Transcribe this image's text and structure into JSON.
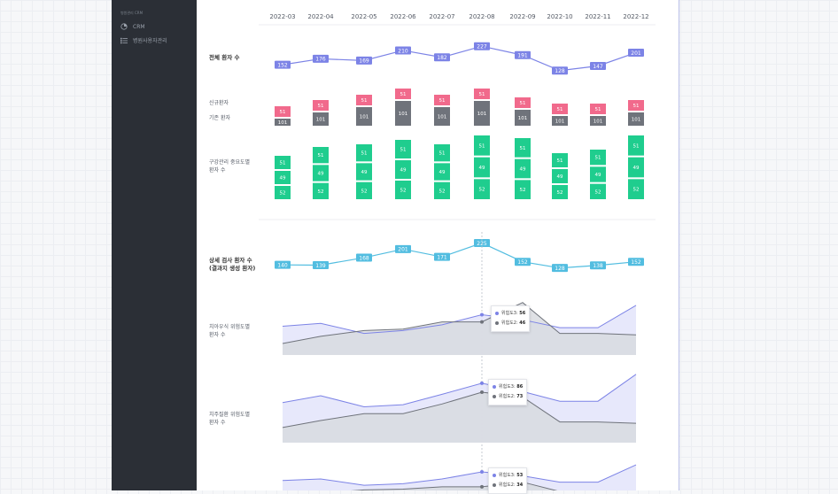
{
  "sidebar": {
    "section_title": "병원관리 CRM",
    "items": [
      {
        "label": "CRM",
        "icon": "chart-pie-icon"
      },
      {
        "label": "병원사용자관리",
        "icon": "list-icon"
      }
    ]
  },
  "months": [
    "2022-03",
    "2022-04",
    "2022-05",
    "2022-06",
    "2022-07",
    "2022-08",
    "2022-09",
    "2022-10",
    "2022-11",
    "2022-12"
  ],
  "labels": {
    "total_patients": "전체 환자 수",
    "new_patients": "신규환자",
    "existing_patients": "기존 환자",
    "oral_mgmt": "구강관리 중요도별\n환자 수",
    "detailed_exam": "상세 검사 환자 수\n(결과지 생성 환자)",
    "caries_risk": "치아우식 위험도별\n환자 수",
    "perio_risk": "치주질환 위험도별\n환자 수"
  },
  "colors": {
    "purple": "#7c83e6",
    "pink": "#f16a8c",
    "gray": "#6f737b",
    "green": "#1fcd8e",
    "cyan": "#52bde0"
  },
  "chart_data": [
    {
      "type": "line",
      "name": "total_patients",
      "categories": [
        "2022-03",
        "2022-04",
        "2022-05",
        "2022-06",
        "2022-07",
        "2022-08",
        "2022-09",
        "2022-10",
        "2022-11",
        "2022-12"
      ],
      "values": [
        152,
        176,
        169,
        210,
        182,
        227,
        191,
        128,
        147,
        201
      ]
    },
    {
      "type": "bar",
      "name": "new_vs_existing",
      "categories": [
        "2022-03",
        "2022-04",
        "2022-05",
        "2022-06",
        "2022-07",
        "2022-08",
        "2022-09",
        "2022-10",
        "2022-11",
        "2022-12"
      ],
      "series": [
        {
          "name": "신규환자",
          "values": [
            51,
            51,
            51,
            51,
            51,
            51,
            51,
            51,
            51,
            51
          ]
        },
        {
          "name": "기존 환자",
          "values": [
            101,
            101,
            101,
            101,
            101,
            101,
            101,
            101,
            101,
            101
          ]
        }
      ]
    },
    {
      "type": "bar",
      "name": "oral_mgmt_importance",
      "categories": [
        "2022-03",
        "2022-04",
        "2022-05",
        "2022-06",
        "2022-07",
        "2022-08",
        "2022-09",
        "2022-10",
        "2022-11",
        "2022-12"
      ],
      "series": [
        {
          "values": [
            51,
            51,
            51,
            51,
            51,
            51,
            51,
            51,
            51,
            51
          ]
        },
        {
          "values": [
            49,
            49,
            49,
            49,
            49,
            49,
            49,
            49,
            49,
            49
          ]
        },
        {
          "values": [
            52,
            52,
            52,
            52,
            52,
            52,
            52,
            52,
            52,
            52
          ]
        }
      ]
    },
    {
      "type": "line",
      "name": "detailed_exam",
      "categories": [
        "2022-03",
        "2022-04",
        "2022-05",
        "2022-06",
        "2022-07",
        "2022-08",
        "2022-09",
        "2022-10",
        "2022-11",
        "2022-12"
      ],
      "values": [
        140,
        139,
        168,
        201,
        171,
        225,
        152,
        128,
        138,
        152
      ]
    },
    {
      "type": "area",
      "name": "caries_risk",
      "categories": [
        "2022-03",
        "2022-04",
        "2022-05",
        "2022-06",
        "2022-07",
        "2022-08",
        "2022-09",
        "2022-10",
        "2022-11",
        "2022-12"
      ],
      "series": [
        {
          "name": "위험도3",
          "values": [
            40,
            44,
            30,
            34,
            42,
            56,
            49,
            38,
            38,
            69
          ]
        },
        {
          "name": "위험도2",
          "values": [
            16,
            26,
            34,
            36,
            46,
            46,
            73,
            30,
            30,
            28
          ]
        }
      ],
      "tooltip": {
        "category": "2022-08",
        "lines": [
          {
            "label": "위험도3:",
            "value": "56"
          },
          {
            "label": "위험도2:",
            "value": "46"
          }
        ]
      }
    },
    {
      "type": "area",
      "name": "perio_risk",
      "categories": [
        "2022-03",
        "2022-04",
        "2022-05",
        "2022-06",
        "2022-07",
        "2022-08",
        "2022-09",
        "2022-10",
        "2022-11",
        "2022-12"
      ],
      "series": [
        {
          "name": "위험도3",
          "values": [
            58,
            68,
            52,
            55,
            70,
            86,
            74,
            60,
            60,
            99
          ]
        },
        {
          "name": "위험도2",
          "values": [
            22,
            32,
            42,
            42,
            56,
            73,
            66,
            30,
            30,
            28
          ]
        }
      ],
      "tooltip": {
        "category": "2022-08",
        "lines": [
          {
            "label": "위험도3:",
            "value": "86"
          },
          {
            "label": "위험도2:",
            "value": "73"
          }
        ]
      }
    },
    {
      "type": "area",
      "name": "third_risk",
      "categories": [
        "2022-03",
        "2022-04",
        "2022-05",
        "2022-06",
        "2022-07",
        "2022-08",
        "2022-09",
        "2022-10",
        "2022-11",
        "2022-12"
      ],
      "series": [
        {
          "name": "위험도3",
          "values": [
            42,
            44,
            36,
            38,
            44,
            53,
            48,
            40,
            40,
            62
          ]
        },
        {
          "name": "위험도2",
          "values": [
            20,
            26,
            30,
            31,
            34,
            34,
            40,
            28,
            28,
            26
          ]
        }
      ],
      "tooltip": {
        "category": "2022-08",
        "lines": [
          {
            "label": "위험도3:",
            "value": "53"
          },
          {
            "label": "위험도2:",
            "value": "34"
          }
        ]
      }
    }
  ]
}
